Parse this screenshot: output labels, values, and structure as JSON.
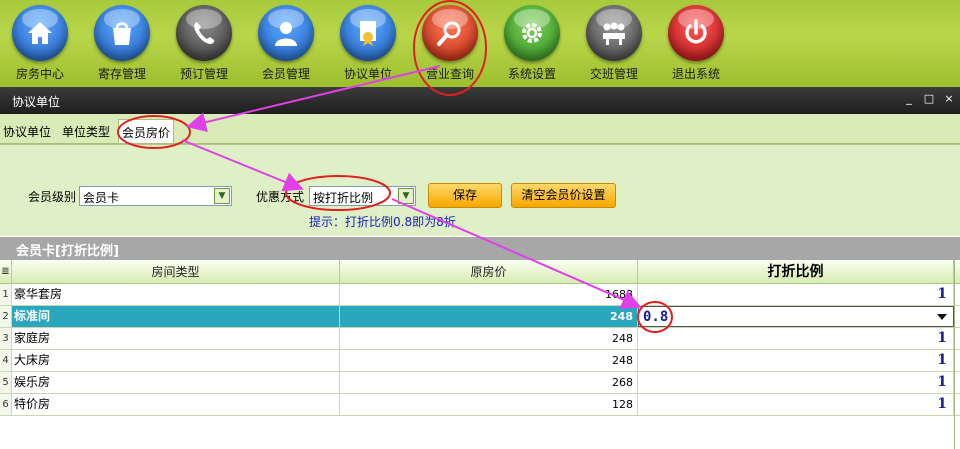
{
  "toolbar": {
    "items": [
      {
        "label": "房务中心",
        "icon": "house-icon",
        "color": "#1f6fd0"
      },
      {
        "label": "寄存管理",
        "icon": "bag-icon",
        "color": "#1f6fd0"
      },
      {
        "label": "预订管理",
        "icon": "phone-icon",
        "color": "#4a4a4a"
      },
      {
        "label": "会员管理",
        "icon": "user-icon",
        "color": "#1f6fd0"
      },
      {
        "label": "协议单位",
        "icon": "certificate-icon",
        "color": "#1f6fd0"
      },
      {
        "label": "营业查询",
        "icon": "magnifier-icon",
        "color": "#d23a22"
      },
      {
        "label": "系统设置",
        "icon": "gear-icon",
        "color": "#3f9a2a"
      },
      {
        "label": "交班管理",
        "icon": "handover-icon",
        "color": "#555555"
      },
      {
        "label": "退出系统",
        "icon": "power-icon",
        "color": "#d42020"
      }
    ]
  },
  "window": {
    "title": "协议单位",
    "controls": [
      "_",
      "□",
      "×"
    ]
  },
  "tabs": [
    {
      "label": "协议单位",
      "active": false
    },
    {
      "label": "单位类型",
      "active": false
    },
    {
      "label": "会员房价",
      "active": true
    }
  ],
  "filters": {
    "level_label": "会员级别",
    "level_value": "会员卡",
    "mode_label": "优惠方式",
    "mode_value": "按打折比例",
    "save_label": "保存",
    "clear_label": "清空会员价设置",
    "hint": "提示：打折比例0.8即为8折"
  },
  "grid": {
    "title": "会员卡[打折比例]",
    "header_icon": "≣",
    "columns": [
      "房间类型",
      "原房价",
      "打折比例"
    ],
    "rows": [
      {
        "index": "1",
        "type": "豪华套房",
        "price": "1688",
        "discount": "1"
      },
      {
        "index": "2",
        "type": "标准间",
        "price": "248",
        "discount": "0.8",
        "selected": true
      },
      {
        "index": "3",
        "type": "家庭房",
        "price": "248",
        "discount": "1"
      },
      {
        "index": "4",
        "type": "大床房",
        "price": "248",
        "discount": "1"
      },
      {
        "index": "5",
        "type": "娱乐房",
        "price": "268",
        "discount": "1"
      },
      {
        "index": "6",
        "type": "特价房",
        "price": "128",
        "discount": "1"
      }
    ]
  },
  "annotation_colors": {
    "circle": "#e02020",
    "arrow": "#e040e8"
  }
}
